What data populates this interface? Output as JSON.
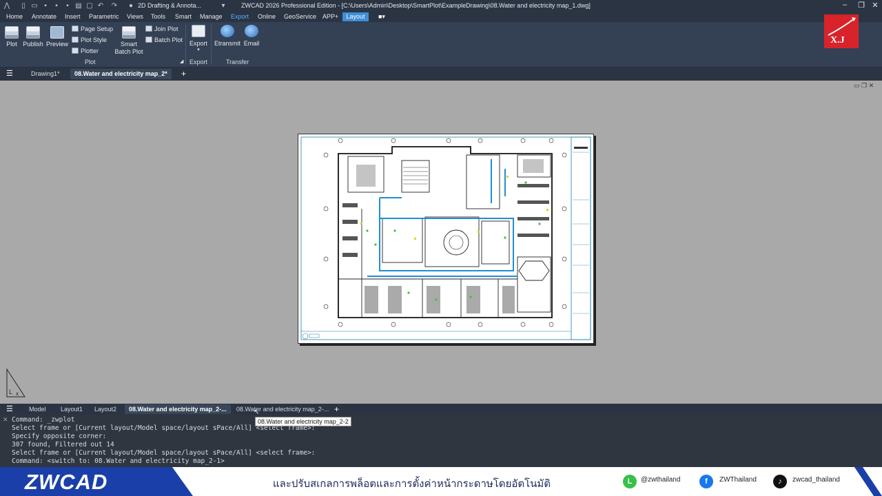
{
  "titlebar": {
    "workspace": "2D Drafting & Annota...",
    "title": "ZWCAD 2026 Professional Edition - [C:\\Users\\Admin\\Desktop\\SmartPlot\\ExampleDrawing\\08.Water and electricity map_1.dwg]"
  },
  "menu": [
    "Home",
    "Annotate",
    "Insert",
    "Parametric",
    "Views",
    "Tools",
    "Smart",
    "Manage",
    "Export",
    "Online",
    "GeoService",
    "APP+"
  ],
  "menu_active": "Export",
  "layout_tab": "Layout",
  "ribbon": {
    "plot": "Plot",
    "publish": "Publish",
    "preview": "Preview",
    "page_setup": "Page Setup",
    "plot_style": "Plot Style",
    "plotter": "Plotter",
    "smart_batch_plot_1": "Smart",
    "smart_batch_plot_2": "Batch Plot",
    "join_plot": "Join Plot",
    "batch_plot": "Batch Plot",
    "export": "Export",
    "etransmit": "Etransmit",
    "email": "Email",
    "group_plot": "Plot",
    "group_export": "Export",
    "group_transfer": "Transfer"
  },
  "logo_text": "X.J",
  "doc_tabs": {
    "tab1": "Drawing1*",
    "tab2": "08.Water and electricity map_2*"
  },
  "layout_tabs": {
    "model": "Model",
    "layout1": "Layout1",
    "layout2": "Layout2",
    "active": "08.Water and electricity map_2-...",
    "next": "08.Water and electricity map_2-..."
  },
  "tooltip": "08.Water and electricity map_2-2",
  "command_lines": [
    "Command: _zwplot",
    "Select frame or [Current layout/Model space/layout sPace/All] <select frame>:",
    "Specify opposite corner:",
    "307 found, Filtered out 14",
    "Select frame or [Current layout/Model space/layout sPace/All] <select frame>:",
    "Command: <switch to: 08.Water and electricity map_2-1>"
  ],
  "banner": {
    "brand": "ZWCAD",
    "tagline": "และปรับสเกลการพล็อตและการตั้งค่าหน้ากระดาษโดยอัตโนมัติ",
    "line": "@zwthailand",
    "facebook": "ZWThailand",
    "tiktok": "zwcad_thailand"
  },
  "colors": {
    "accent": "#3d8fd6",
    "ribbon": "#344154",
    "banner_blue": "#1a3fa8"
  }
}
